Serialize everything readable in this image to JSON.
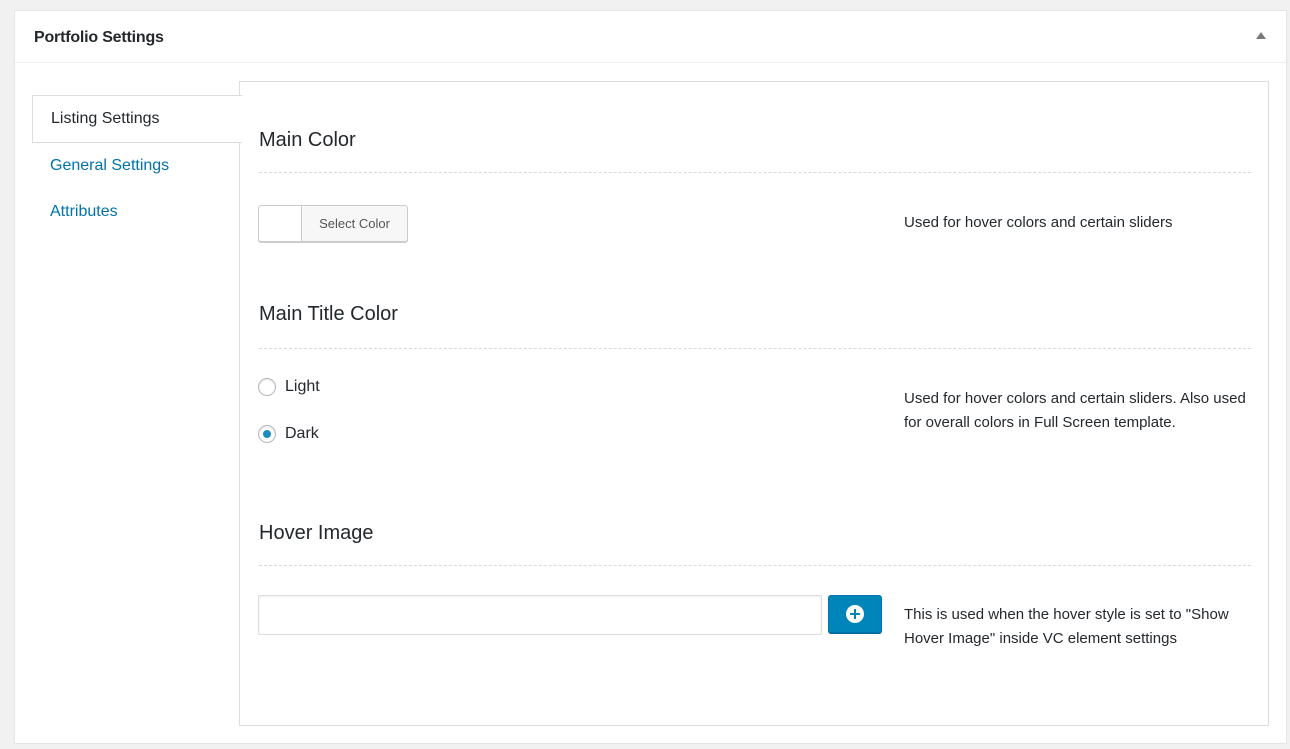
{
  "metabox": {
    "title": "Portfolio Settings",
    "toggle_icon": "triangle-up-icon"
  },
  "tabs": [
    {
      "label": "Listing Settings",
      "active": true
    },
    {
      "label": "General Settings",
      "active": false
    },
    {
      "label": "Attributes",
      "active": false
    }
  ],
  "main_color": {
    "title": "Main Color",
    "button_label": "Select Color",
    "swatch_color": "#ffffff",
    "description": "Used for hover colors and certain sliders"
  },
  "main_title_color": {
    "title": "Main Title Color",
    "options": [
      {
        "label": "Light",
        "checked": false
      },
      {
        "label": "Dark",
        "checked": true
      }
    ],
    "description": "Used for hover colors and certain sliders. Also used for overall colors in Full Screen template."
  },
  "hover_image": {
    "title": "Hover Image",
    "input_value": "",
    "add_button_icon": "plus-circle-icon",
    "description": "This is used when the hover style is set to \"Show Hover Image\" inside VC element settings"
  },
  "colors": {
    "accent": "#0085ba",
    "link": "#0073aa",
    "text": "#23282d"
  }
}
